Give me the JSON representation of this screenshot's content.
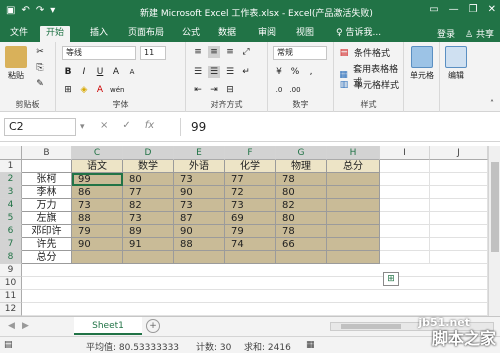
{
  "window": {
    "title": "新建 Microsoft Excel 工作表.xlsx - Excel(产品激活失败)",
    "qat_icons": [
      "save-icon",
      "undo-icon",
      "redo-icon",
      "customize-icon"
    ]
  },
  "tabs": [
    "文件",
    "开始",
    "插入",
    "页面布局",
    "公式",
    "数据",
    "审阅",
    "视图"
  ],
  "active_tab": "开始",
  "tell_me": "告诉我...",
  "login": "登录",
  "share": "共享",
  "ribbon": {
    "clipboard": {
      "paste": "粘贴",
      "label": "剪贴板"
    },
    "font": {
      "name": "等线",
      "size": "11",
      "bold": "B",
      "italic": "I",
      "underline": "U",
      "grow": "A",
      "shrink": "A",
      "wen": "wén",
      "label": "字体"
    },
    "align": {
      "label": "对齐方式"
    },
    "number": {
      "format": "常规",
      "percent": "%",
      "comma": ",",
      "label": "数字"
    },
    "styles": {
      "conditional": "条件格式",
      "table": "套用表格格式",
      "cell": "单元格样式",
      "label": "样式"
    },
    "cells": {
      "label": "单元格"
    },
    "editing": {
      "label": "编辑"
    }
  },
  "formula_bar": {
    "name_box": "C2",
    "cancel": "×",
    "enter": "✓",
    "fx": "fx",
    "value": "99"
  },
  "columns": [
    "B",
    "C",
    "D",
    "E",
    "F",
    "G",
    "H",
    "I",
    "J"
  ],
  "rows": [
    "1",
    "2",
    "3",
    "4",
    "5",
    "6",
    "7",
    "8",
    "9",
    "10",
    "11",
    "12"
  ],
  "table": {
    "headers": [
      "语文",
      "数学",
      "外语",
      "化学",
      "物理",
      "总分"
    ],
    "names": [
      "张柯",
      "李林",
      "万力",
      "左旗",
      "邓印许",
      "许先",
      "总分"
    ],
    "scores": [
      [
        "99",
        "80",
        "73",
        "77",
        "78"
      ],
      [
        "86",
        "77",
        "90",
        "72",
        "80"
      ],
      [
        "73",
        "82",
        "73",
        "73",
        "82"
      ],
      [
        "88",
        "73",
        "87",
        "69",
        "80"
      ],
      [
        "79",
        "89",
        "90",
        "79",
        "78"
      ],
      [
        "90",
        "91",
        "88",
        "74",
        "66"
      ]
    ]
  },
  "sheet_tab": "Sheet1",
  "status": {
    "average": "平均值: 80.53333333",
    "count": "计数: 30",
    "sum": "求和: 2416"
  },
  "watermark": {
    "line1": "jb51.net",
    "line2": "脚本之家"
  },
  "colors": {
    "excel_green": "#217346",
    "tan": "#c9bb97",
    "header_fill": "#ede4c6"
  }
}
